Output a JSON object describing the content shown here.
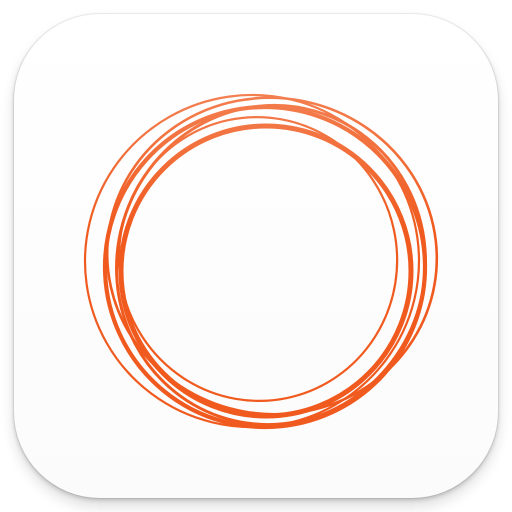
{
  "icon": {
    "name": "orange-scribble-circle-icon",
    "background_color": "#ffffff",
    "stroke_color": "#f05a1e"
  }
}
